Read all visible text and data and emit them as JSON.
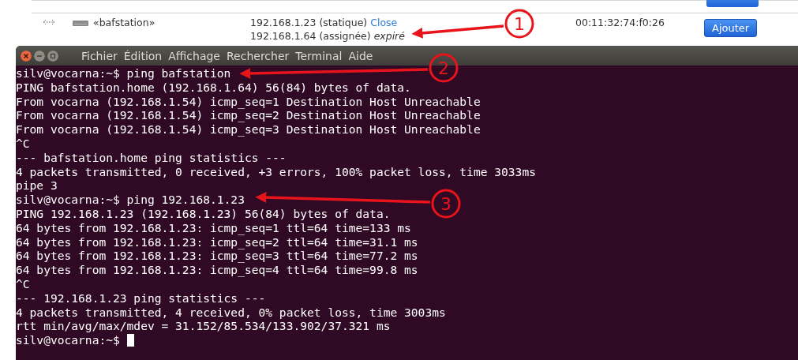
{
  "host_row": {
    "name": "«bafstation»",
    "addresses": [
      {
        "ip": "192.168.1.23",
        "type": "(statique)",
        "note": "Close",
        "kind": "link"
      },
      {
        "ip": "192.168.1.64",
        "type": "(assignée)",
        "note": "expiré",
        "kind": "expired"
      }
    ],
    "mac": "00:11:32:74:f0:26",
    "button": "Ajouter"
  },
  "terminal": {
    "menu": [
      "Fichier",
      "Édition",
      "Affichage",
      "Rechercher",
      "Terminal",
      "Aide"
    ],
    "lines": [
      "silv@vocarna:~$ ping bafstation",
      "PING bafstation.home (192.168.1.64) 56(84) bytes of data.",
      "From vocarna (192.168.1.54) icmp_seq=1 Destination Host Unreachable",
      "From vocarna (192.168.1.54) icmp_seq=2 Destination Host Unreachable",
      "From vocarna (192.168.1.54) icmp_seq=3 Destination Host Unreachable",
      "^C",
      "--- bafstation.home ping statistics ---",
      "4 packets transmitted, 0 received, +3 errors, 100% packet loss, time 3033ms",
      "pipe 3",
      "silv@vocarna:~$ ping 192.168.1.23",
      "PING 192.168.1.23 (192.168.1.23) 56(84) bytes of data.",
      "64 bytes from 192.168.1.23: icmp_seq=1 ttl=64 time=133 ms",
      "64 bytes from 192.168.1.23: icmp_seq=2 ttl=64 time=31.1 ms",
      "64 bytes from 192.168.1.23: icmp_seq=3 ttl=64 time=77.2 ms",
      "64 bytes from 192.168.1.23: icmp_seq=4 ttl=64 time=99.8 ms",
      "^C",
      "--- 192.168.1.23 ping statistics ---",
      "4 packets transmitted, 4 received, 0% packet loss, time 3003ms",
      "rtt min/avg/max/mdev = 31.152/85.534/133.902/37.321 ms",
      "silv@vocarna:~$"
    ]
  },
  "annotations": [
    {
      "label": "1"
    },
    {
      "label": "2"
    },
    {
      "label": "3"
    }
  ]
}
